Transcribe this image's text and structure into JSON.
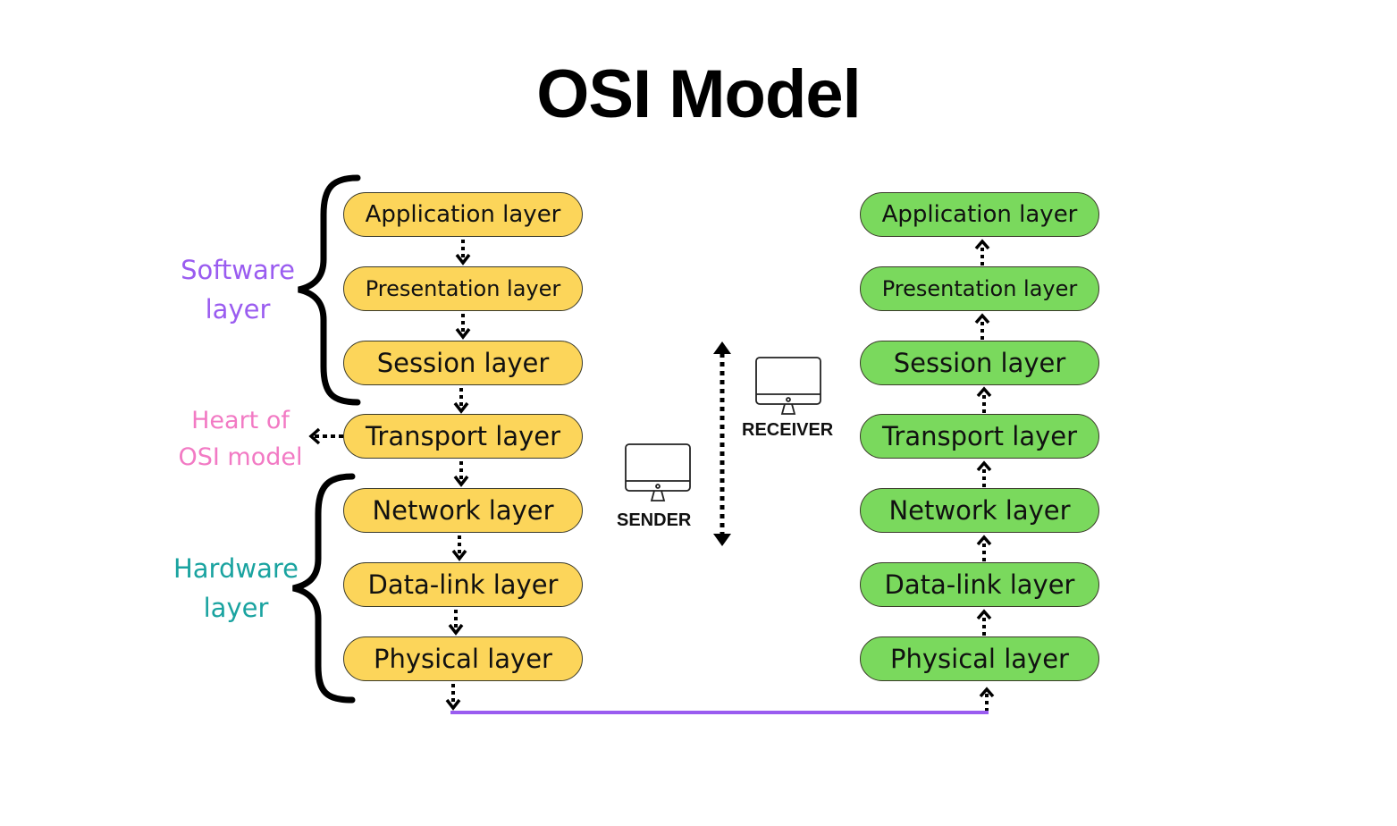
{
  "title": "OSI Model",
  "sender_stack": {
    "color": "#fcd55a",
    "direction": "down",
    "layers": [
      {
        "label": "Application layer"
      },
      {
        "label": "Presentation layer"
      },
      {
        "label": "Session layer"
      },
      {
        "label": "Transport layer"
      },
      {
        "label": "Network layer"
      },
      {
        "label": "Data-link layer"
      },
      {
        "label": "Physical layer"
      }
    ]
  },
  "receiver_stack": {
    "color": "#7ad95d",
    "direction": "up",
    "layers": [
      {
        "label": "Application layer"
      },
      {
        "label": "Presentation layer"
      },
      {
        "label": "Session layer"
      },
      {
        "label": "Transport layer"
      },
      {
        "label": "Network layer"
      },
      {
        "label": "Data-link layer"
      },
      {
        "label": "Physical layer"
      }
    ]
  },
  "groups": {
    "software": {
      "line1": "Software",
      "line2": "layer",
      "color": "#9a5cf0"
    },
    "heart": {
      "line1": "Heart of",
      "line2": "OSI model",
      "color": "#f27ac4"
    },
    "hardware": {
      "line1": "Hardware",
      "line2": "layer",
      "color": "#1aa3a0"
    }
  },
  "devices": {
    "sender": {
      "label": "SENDER",
      "icon": "desktop-monitor-icon"
    },
    "receiver": {
      "label": "RECEIVER",
      "icon": "desktop-monitor-icon"
    }
  },
  "connection": {
    "color": "#9a5cf0",
    "meaning": "physical medium"
  }
}
